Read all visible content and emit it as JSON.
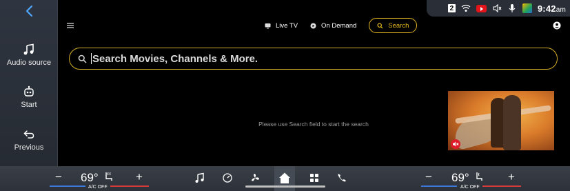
{
  "rail": {
    "items": [
      {
        "label": "Audio source"
      },
      {
        "label": "Start"
      },
      {
        "label": "Previous"
      }
    ]
  },
  "status": {
    "badge": "2",
    "time": "9:42",
    "ampm": "am"
  },
  "header": {
    "tabs": [
      {
        "label": "Live TV"
      },
      {
        "label": "On Demand"
      },
      {
        "label": "Search"
      }
    ]
  },
  "search": {
    "placeholder": "Search Movies, Channels & More."
  },
  "hint": "Please use Search field to start the search",
  "climate": {
    "left": {
      "temp": "69°",
      "ac": "A/C OFF",
      "minus": "−",
      "plus": "+"
    },
    "right": {
      "temp": "69°",
      "ac": "A/C OFF",
      "minus": "−",
      "plus": "+"
    }
  },
  "colors": {
    "accent": "#e6b91e",
    "rail": "#2f3540",
    "dock": "#33383f"
  }
}
